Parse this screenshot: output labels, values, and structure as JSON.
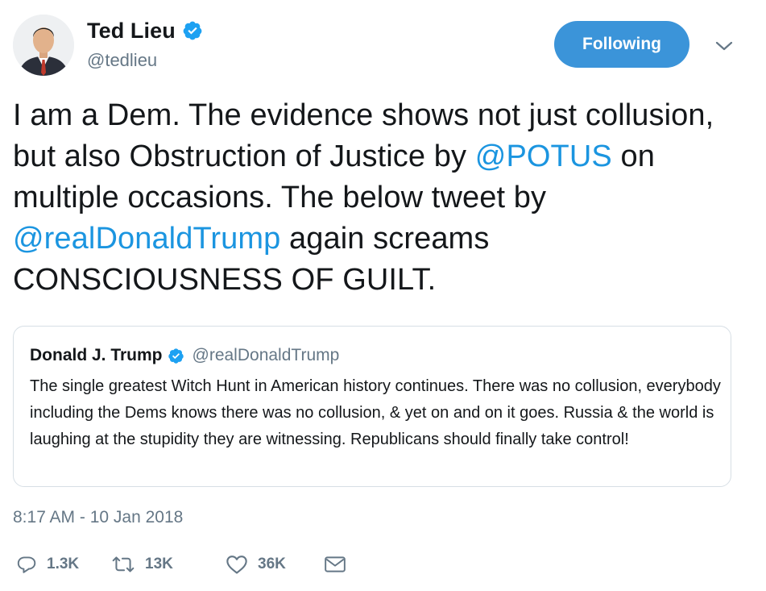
{
  "author": {
    "display_name": "Ted Lieu",
    "handle": "@tedlieu",
    "verified": true,
    "avatar_icon": "profile-photo"
  },
  "follow_button": {
    "label": "Following"
  },
  "more_menu_icon": "chevron-down-icon",
  "tweet": {
    "text_parts": [
      {
        "type": "text",
        "value": "I am a Dem. The evidence shows not just collusion, but also Obstruction of Justice by "
      },
      {
        "type": "mention",
        "value": "@POTUS"
      },
      {
        "type": "text",
        "value": " on multiple occasions. The below tweet by "
      },
      {
        "type": "mention",
        "value": "@realDonaldTrump"
      },
      {
        "type": "text",
        "value": " again screams CONSCIOUSNESS OF GUILT."
      }
    ]
  },
  "quoted_tweet": {
    "display_name": "Donald J. Trump",
    "handle": "@realDonaldTrump",
    "verified": true,
    "text": "The single greatest Witch Hunt in American history continues. There was no collusion, everybody including the Dems knows there was no collusion, & yet on and on it goes. Russia & the world is laughing at the stupidity they are witnessing. Republicans should finally take control!"
  },
  "timestamp": "8:17 AM - 10 Jan 2018",
  "actions": {
    "replies": "1.3K",
    "retweets": "13K",
    "likes": "36K"
  },
  "colors": {
    "link": "#1b95e0",
    "button_bg": "#3b94d9",
    "muted": "#657786",
    "border": "#d7dfe5",
    "verified": "#1da1f2"
  }
}
